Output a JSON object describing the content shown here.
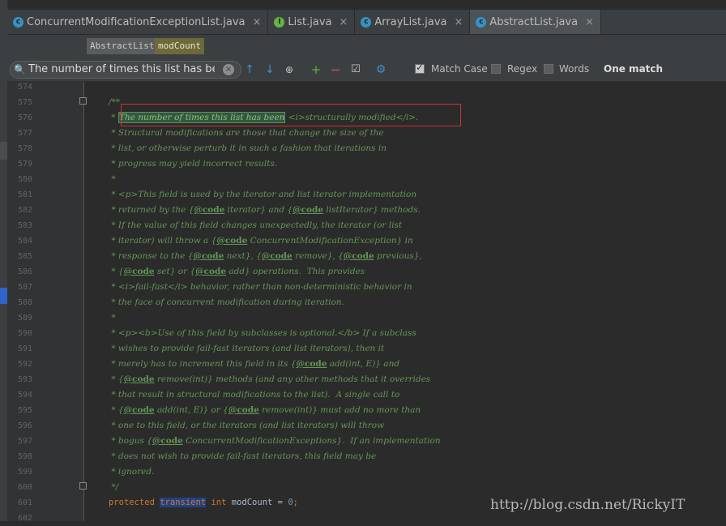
{
  "tabs": [
    {
      "label": "ConcurrentModificationExceptionList.java",
      "icon": "c",
      "kind": "class",
      "active": false
    },
    {
      "label": "List.java",
      "icon": "I",
      "kind": "interface",
      "active": false
    },
    {
      "label": "ArrayList.java",
      "icon": "c",
      "kind": "class",
      "active": false
    },
    {
      "label": "AbstractList.java",
      "icon": "c",
      "kind": "class",
      "active": true
    }
  ],
  "breadcrumb": {
    "items": [
      "AbstractList",
      "modCount"
    ]
  },
  "search": {
    "value": "The number of times this list has been",
    "match_case_label": "Match Case",
    "match_case_checked": true,
    "regex_label": "Regex",
    "regex_checked": false,
    "words_label": "Words",
    "words_checked": false,
    "result": "One match"
  },
  "editor": {
    "lines": [
      {
        "num": "574",
        "text": ""
      },
      {
        "num": "575",
        "text": "/**"
      },
      {
        "num": "576",
        "text": " * The number of times this list has been <i>structurally modified</i>."
      },
      {
        "num": "577",
        "text": " * Structural modifications are those that change the size of the"
      },
      {
        "num": "578",
        "text": " * list, or otherwise perturb it in such a fashion that iterations in"
      },
      {
        "num": "579",
        "text": " * progress may yield incorrect results."
      },
      {
        "num": "580",
        "text": " *"
      },
      {
        "num": "581",
        "text": " * <p>This field is used by the iterator and list iterator implementation"
      },
      {
        "num": "582",
        "text": " * returned by the {@code iterator} and {@code listIterator} methods."
      },
      {
        "num": "583",
        "text": " * If the value of this field changes unexpectedly, the iterator (or list"
      },
      {
        "num": "584",
        "text": " * iterator) will throw a {@code ConcurrentModificationException} in"
      },
      {
        "num": "585",
        "text": " * response to the {@code next}, {@code remove}, {@code previous},"
      },
      {
        "num": "586",
        "text": " * {@code set} or {@code add} operations.  This provides"
      },
      {
        "num": "587",
        "text": " * <i>fail-fast</i> behavior, rather than non-deterministic behavior in"
      },
      {
        "num": "588",
        "text": " * the face of concurrent modification during iteration."
      },
      {
        "num": "589",
        "text": " *"
      },
      {
        "num": "590",
        "text": " * <p><b>Use of this field by subclasses is optional.</b> If a subclass"
      },
      {
        "num": "591",
        "text": " * wishes to provide fail-fast iterators (and list iterators), then it"
      },
      {
        "num": "592",
        "text": " * merely has to increment this field in its {@code add(int, E)} and"
      },
      {
        "num": "593",
        "text": " * {@code remove(int)} methods (and any other methods that it overrides"
      },
      {
        "num": "594",
        "text": " * that result in structural modifications to the list).  A single call to"
      },
      {
        "num": "595",
        "text": " * {@code add(int, E)} or {@code remove(int)} must add no more than"
      },
      {
        "num": "596",
        "text": " * one to this field, or the iterators (and list iterators) will throw"
      },
      {
        "num": "597",
        "text": " * bogus {@code ConcurrentModificationExceptions}.  If an implementation"
      },
      {
        "num": "598",
        "text": " * does not wish to provide fail-fast iterators, this field may be"
      },
      {
        "num": "599",
        "text": " * ignored."
      },
      {
        "num": "600",
        "text": " */"
      },
      {
        "num": "601",
        "text": "protected transient int modCount = 0;"
      },
      {
        "num": "602",
        "text": ""
      }
    ],
    "search_hit": "The number of times this list has been",
    "selected_word": "transient"
  },
  "watermark": "http://blog.csdn.net/RickyIT",
  "colors": {
    "comment": "#629755",
    "keyword": "#cc7832",
    "number": "#6897bb",
    "highlight_box": "#d32f2f"
  }
}
